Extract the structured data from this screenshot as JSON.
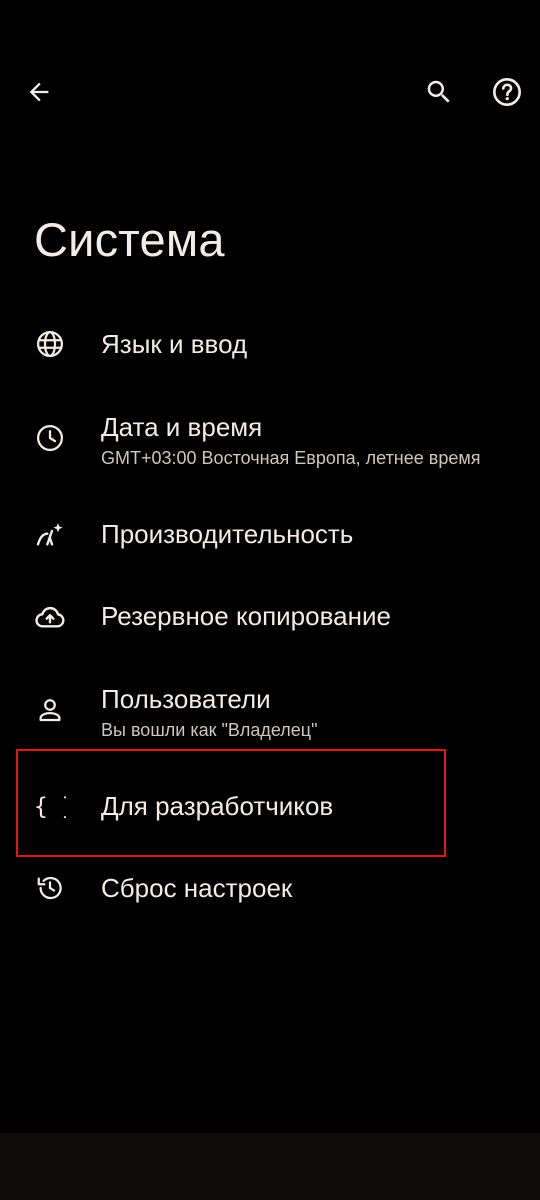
{
  "toolbar": {
    "back_icon": "arrow-back-icon",
    "search_icon": "search-icon",
    "help_icon": "help-icon"
  },
  "page": {
    "title": "Система"
  },
  "items": [
    {
      "icon": "globe-icon",
      "label": "Язык и ввод"
    },
    {
      "icon": "clock-icon",
      "label": "Дата и время",
      "sub": "GMT+03:00 Восточная Европа, летнее время"
    },
    {
      "icon": "performance-icon",
      "label": "Производительность"
    },
    {
      "icon": "cloud-upload-icon",
      "label": "Резервное копирование"
    },
    {
      "icon": "person-icon",
      "label": "Пользователи",
      "sub": "Вы вошли как \"Владелец\""
    },
    {
      "icon": "braces-icon",
      "label": "Для разработчиков",
      "highlighted": true
    },
    {
      "icon": "history-icon",
      "label": "Сброс настроек"
    }
  ],
  "colors": {
    "background": "#000000",
    "text": "#f3ece6",
    "subtext": "#cfc6bf",
    "highlight": "#e0161b"
  }
}
